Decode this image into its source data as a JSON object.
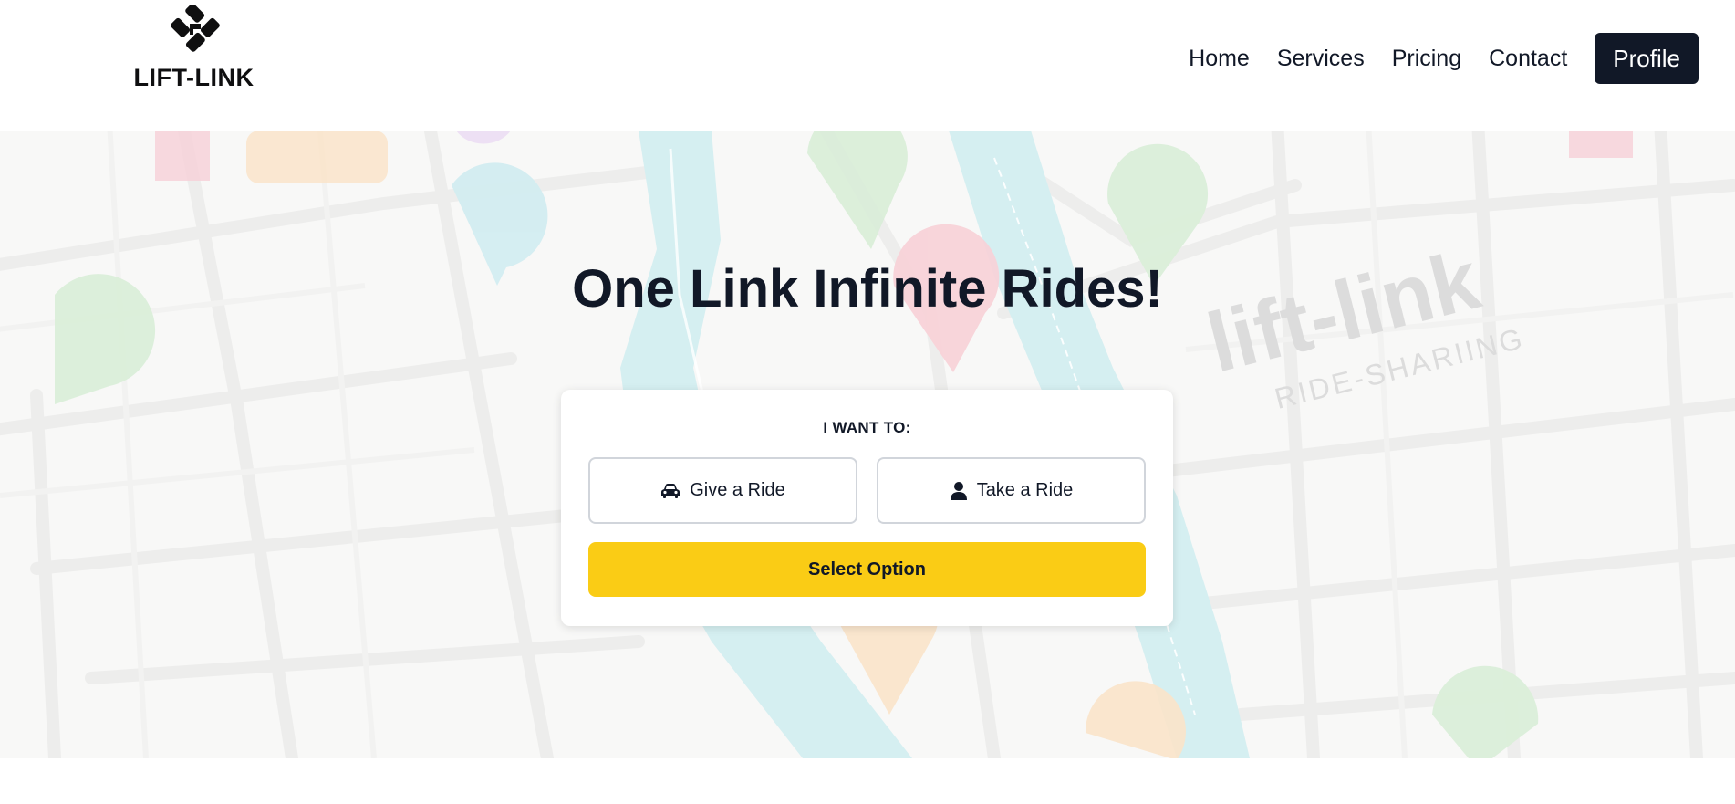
{
  "header": {
    "logo_text": "LIFT-LINK",
    "logo_icon": "link-logo-icon",
    "nav": [
      {
        "label": "Home"
      },
      {
        "label": "Services"
      },
      {
        "label": "Pricing"
      },
      {
        "label": "Contact"
      }
    ],
    "profile_label": "Profile"
  },
  "hero": {
    "title": "One Link Infinite Rides!",
    "background_watermark": "lift-link",
    "background_watermark_sub": "RIDE-SHARIING",
    "card": {
      "label": "I WANT TO:",
      "give_label": "Give a Ride",
      "give_icon": "car-icon",
      "take_label": "Take a Ride",
      "take_icon": "user-icon",
      "select_label": "Select Option"
    }
  },
  "colors": {
    "primary_dark": "#111827",
    "accent_yellow": "#facc15",
    "river": "#bfe6ea",
    "pin_green": "#c5e5c3",
    "pin_blue": "#b9e3ea",
    "pin_pink": "#f5b9c2",
    "pin_orange": "#f8d6ad"
  }
}
